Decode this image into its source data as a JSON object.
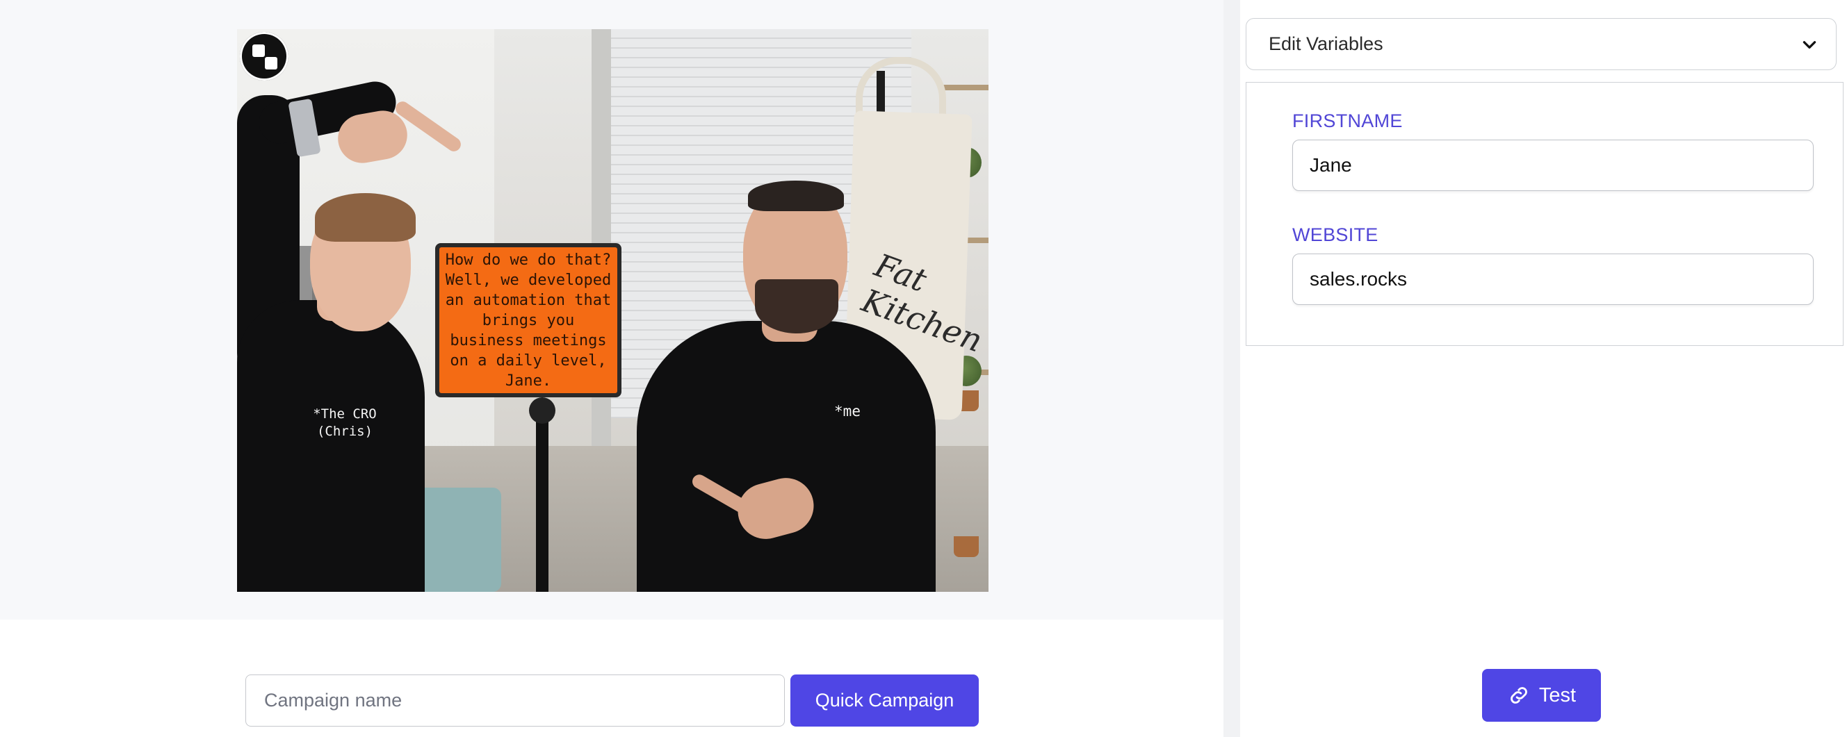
{
  "preview": {
    "sign_text": "How do we do that? Well, we developed an automation that brings you business meetings on a daily level, Jane.",
    "caption_left": "*The CRO (Chris)",
    "caption_right": "*me",
    "bag_print": "Fat Kitchen"
  },
  "campaign": {
    "name_placeholder": "Campaign name",
    "name_value": "",
    "quick_campaign_label": "Quick Campaign"
  },
  "variables": {
    "header_title": "Edit Variables",
    "fields": [
      {
        "label": "FIRSTNAME",
        "value": "Jane"
      },
      {
        "label": "WEBSITE",
        "value": "sales.rocks"
      }
    ]
  },
  "actions": {
    "test_label": "Test"
  },
  "colors": {
    "accent": "#4f46e5",
    "label": "#5146d6",
    "sign": "#f46b14"
  },
  "icons": {
    "header_chevron": "chevron-down-icon",
    "test_button": "link-icon",
    "brand": "brand-logo"
  }
}
